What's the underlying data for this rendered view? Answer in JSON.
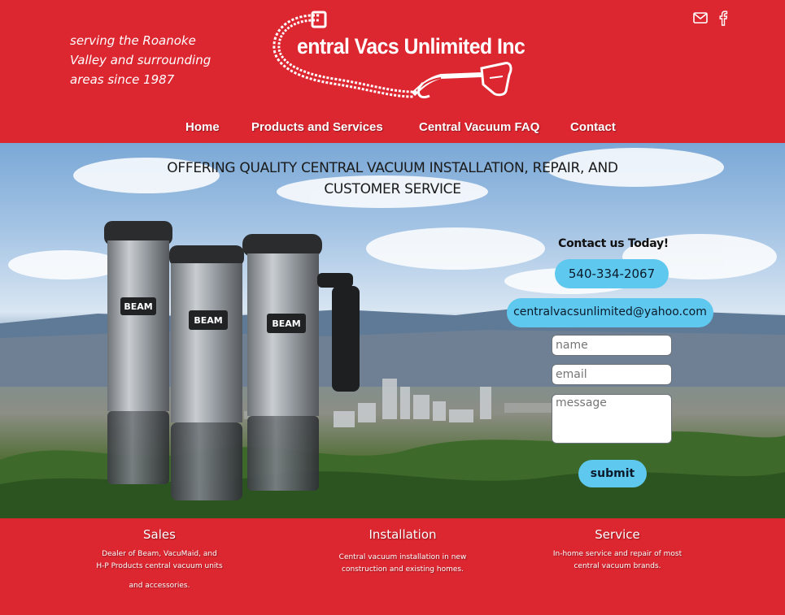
{
  "header": {
    "tagline_lines": [
      "serving the Roanoke",
      "Valley and surrounding",
      "areas since 1987"
    ],
    "logo_text": "entral Vacs Unlimited Inc",
    "logo_letter": "C",
    "icons": [
      "mail-icon",
      "facebook-icon"
    ]
  },
  "nav": {
    "items": [
      {
        "label": "Home"
      },
      {
        "label": "Products and Services"
      },
      {
        "label": "Central Vacuum FAQ"
      },
      {
        "label": "Contact"
      }
    ]
  },
  "hero": {
    "headline_line1": "OFFERING QUALITY CENTRAL VACUUM INSTALLATION, REPAIR, AND",
    "headline_line2": "CUSTOMER SERVICE",
    "product_brand": "BEAM"
  },
  "contact": {
    "title": "Contact us Today!",
    "phone": "540-334-2067",
    "email": "centralvacsunlimited@yahoo.com",
    "name_placeholder": "name",
    "email_placeholder": "email",
    "message_placeholder": "message",
    "submit_label": "submit"
  },
  "footer": {
    "sales": {
      "title": "Sales",
      "line1": "Dealer of Beam, VacuMaid, and",
      "line2": "H-P Products central vacuum units",
      "line3": "and accessories."
    },
    "installation": {
      "title": "Installation",
      "line1": "Central vacuum installation in new",
      "line2": "construction and existing homes."
    },
    "service": {
      "title": "Service",
      "line1": "In-home service and repair of most",
      "line2": "central vacuum brands."
    }
  },
  "colors": {
    "brand_red": "#dc2630",
    "accent_blue": "#5ec8ef",
    "text_white": "#ffffff"
  }
}
